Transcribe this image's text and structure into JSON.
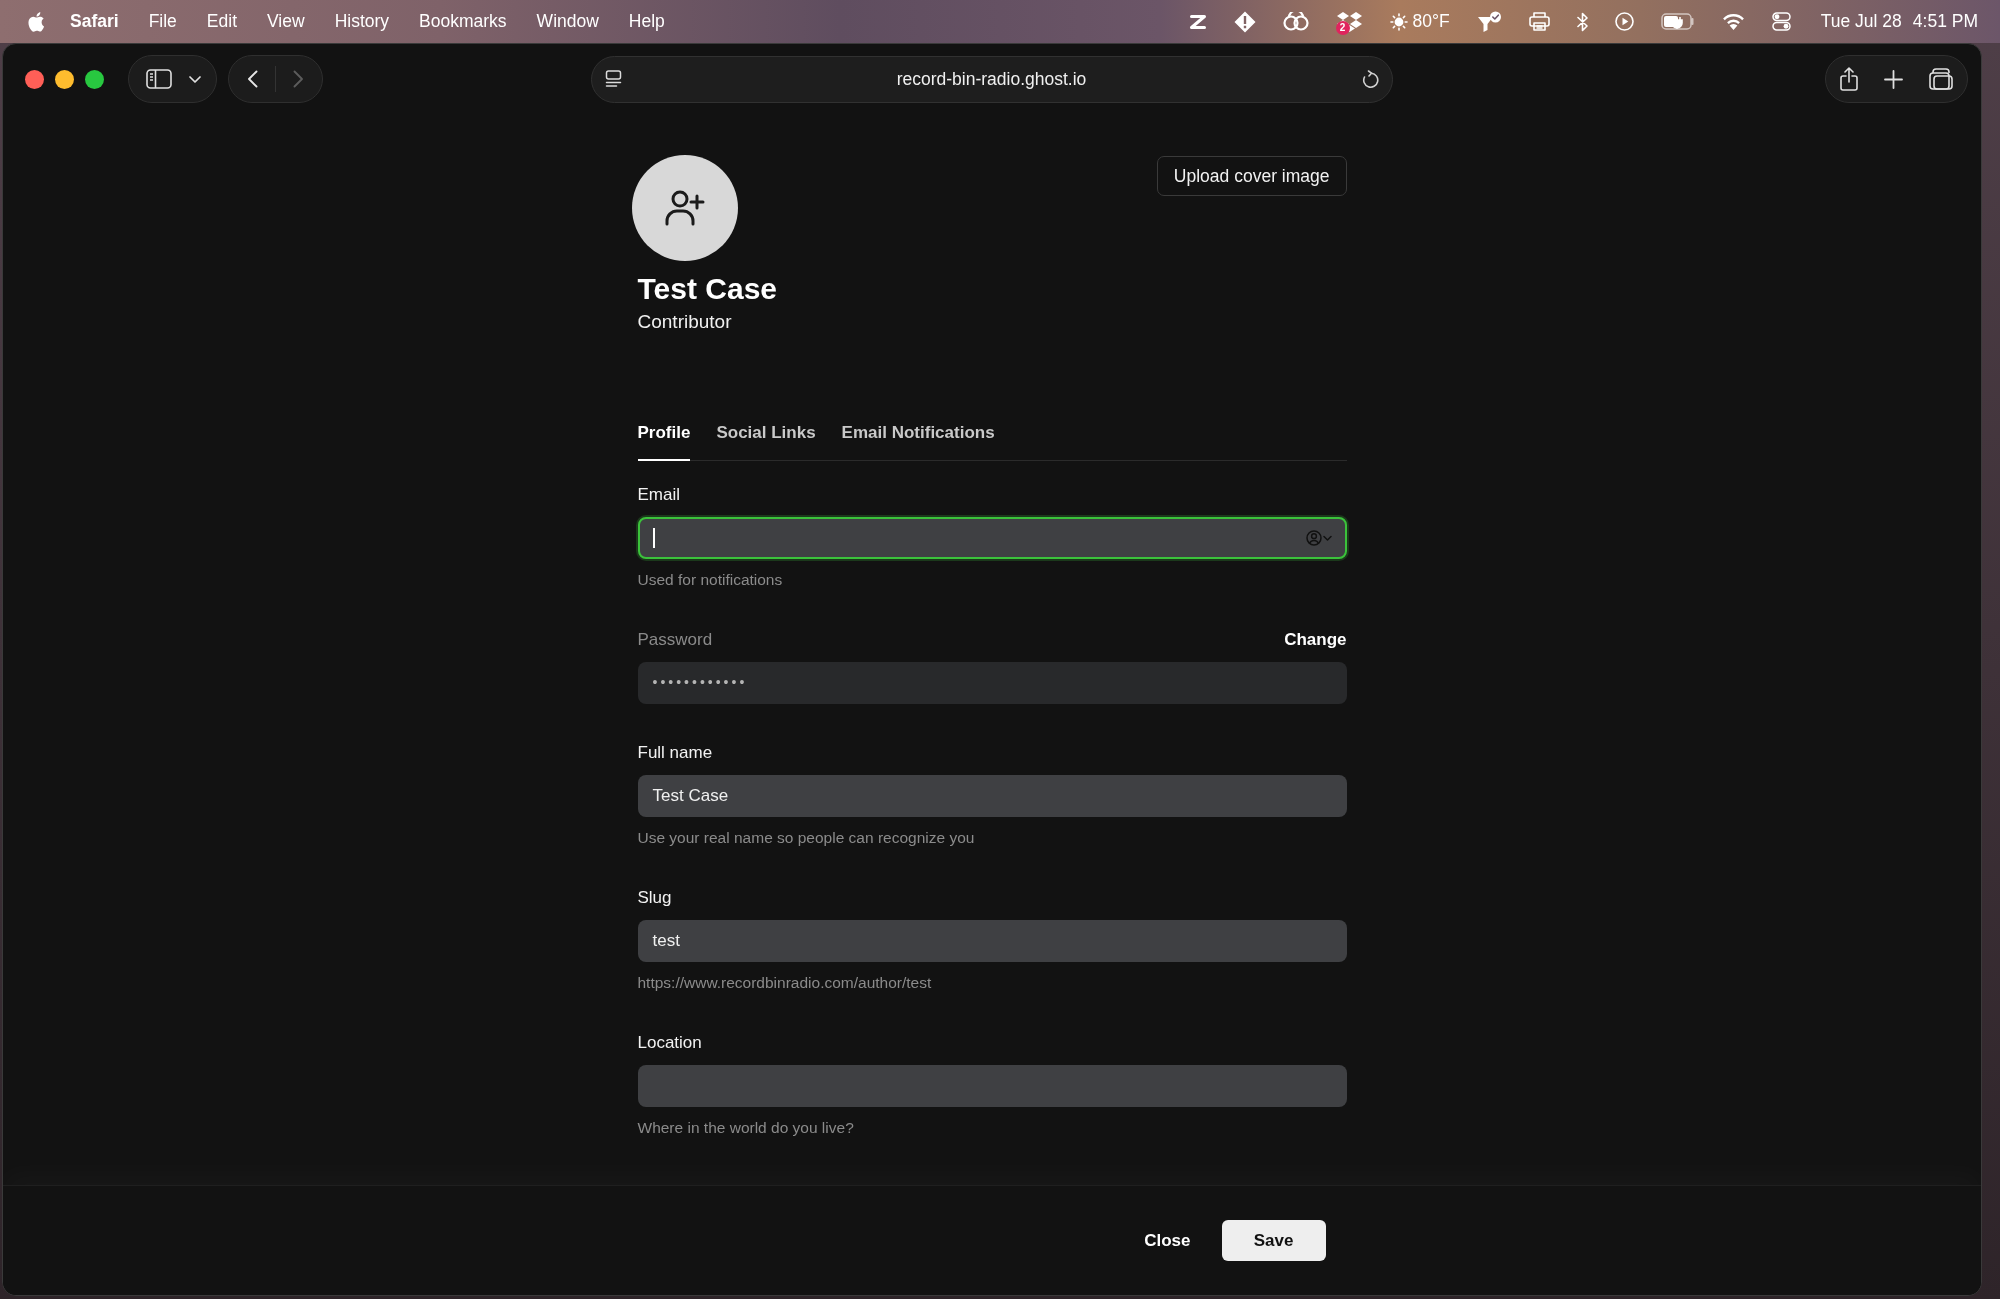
{
  "menu_bar": {
    "app_name": "Safari",
    "menus": [
      "File",
      "Edit",
      "View",
      "History",
      "Bookmarks",
      "Window",
      "Help"
    ],
    "notification_badge": "2",
    "temperature": "80°F",
    "date": "Tue Jul 28",
    "time": "4:51 PM"
  },
  "browser": {
    "url": "record-bin-radio.ghost.io",
    "back_disabled": false,
    "forward_disabled": true
  },
  "profile": {
    "name": "Test Case",
    "role": "Contributor",
    "cover_button": "Upload cover image"
  },
  "tabs": [
    {
      "label": "Profile",
      "selected": true
    },
    {
      "label": "Social Links",
      "selected": false
    },
    {
      "label": "Email Notifications",
      "selected": false
    }
  ],
  "fields": [
    {
      "label": "Email",
      "kind": "email",
      "focused": true,
      "disabled": false,
      "hint": "Used for notifications"
    },
    {
      "label": "Password",
      "kind": "password",
      "focused": false,
      "disabled": true,
      "value": "••••••••••••",
      "action": "Change"
    },
    {
      "label": "Full name",
      "kind": "text",
      "focused": false,
      "disabled": false,
      "value": "Test Case",
      "hint": "Use your real name so people can recognize you"
    },
    {
      "label": "Slug",
      "kind": "text",
      "focused": false,
      "disabled": false,
      "value": "test",
      "hint": "https://www.recordbinradio.com/author/test"
    },
    {
      "label": "Location",
      "kind": "text",
      "focused": false,
      "disabled": false,
      "hint": "Where in the world do you live?"
    }
  ],
  "footer": {
    "buttons": [
      {
        "label": "Close",
        "kind": "secondary"
      },
      {
        "label": "Save",
        "kind": "primary"
      }
    ]
  }
}
